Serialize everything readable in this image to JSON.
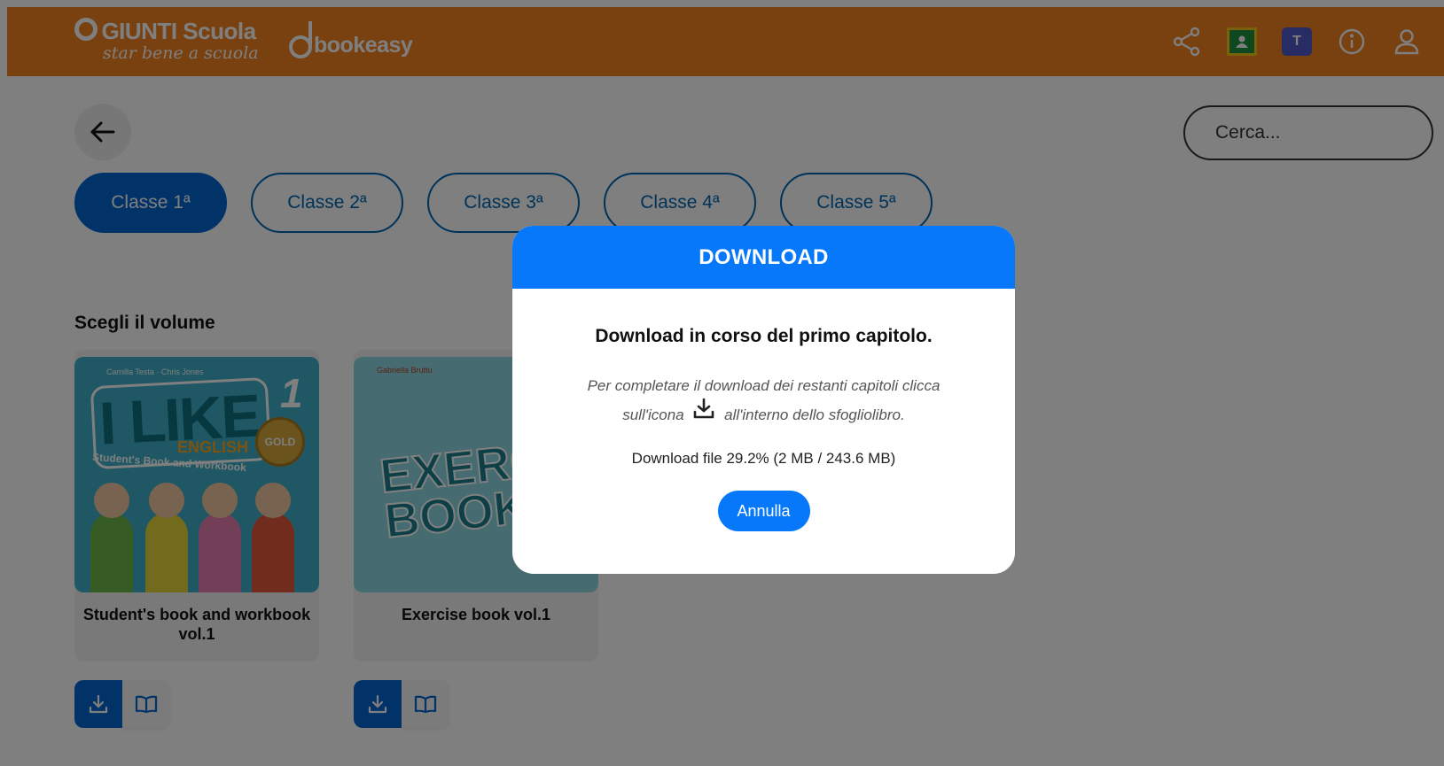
{
  "header": {
    "brand_name": "GIUNTI Scuola",
    "tagline": "star bene a scuola",
    "bookeasy": "bookeasy",
    "color": "#f58220",
    "icons": [
      "share-icon",
      "google-classroom-icon",
      "microsoft-teams-icon",
      "info-icon",
      "user-icon"
    ]
  },
  "search": {
    "placeholder": "Cerca..."
  },
  "tabs": [
    {
      "label": "Classe 1ª",
      "active": true
    },
    {
      "label": "Classe 2ª"
    },
    {
      "label": "Classe 3ª"
    },
    {
      "label": "Classe 4ª"
    },
    {
      "label": "Classe 5ª"
    }
  ],
  "section_title": "Scegli il volume",
  "books": [
    {
      "name": "Student's book and workbook vol.1",
      "cover": {
        "authors": "Camilla Testa · Chris Jones",
        "title": "I LIKE",
        "number": "1",
        "subtitle": "ENGLISH",
        "badge": "GOLD",
        "caption": "Student's Book and Workbook"
      }
    },
    {
      "name": "Exercise book vol.1",
      "cover": {
        "authors": "Gabriella Bruttu",
        "title": "EXERCISE BOOK"
      }
    }
  ],
  "modal": {
    "header": "DOWNLOAD",
    "title": "Download in corso del primo capitolo.",
    "text_before_icon": "Per completare il download dei restanti capitoli clicca sull'icona",
    "text_after_icon": "all'interno dello sfogliolibro.",
    "progress": "Download file 29.2% (2 MB / 243.6 MB)",
    "progress_percent": 29.2,
    "cancel_label": "Annulla",
    "accent": "#0678f9"
  }
}
